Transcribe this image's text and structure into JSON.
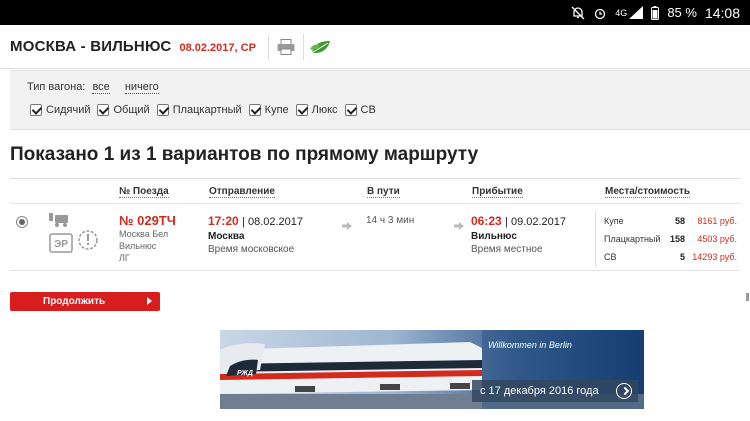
{
  "status_bar": {
    "battery_level": "85 %",
    "network": "4G",
    "time": "14:08"
  },
  "header": {
    "route": "МОСКВА - ВИЛЬНЮС",
    "date": "08.02.2017, СР",
    "print_icon": "printer-icon",
    "eco_icon": "leaf-icon"
  },
  "filter": {
    "type_label": "Тип вагона:",
    "link_all": "все",
    "link_none": "ничего",
    "options": [
      {
        "label": "Сидячий",
        "checked": true
      },
      {
        "label": "Общий",
        "checked": true
      },
      {
        "label": "Плацкартный",
        "checked": true
      },
      {
        "label": "Купе",
        "checked": true
      },
      {
        "label": "Люкс",
        "checked": true
      },
      {
        "label": "СВ",
        "checked": true
      }
    ]
  },
  "results": {
    "title": "Показано 1 из 1 вариантов по прямому маршруту"
  },
  "table": {
    "columns": {
      "train": "№ Поезда",
      "departure": "Отправление",
      "travel": "В пути",
      "arrival": "Прибытие",
      "seats": "Места/стоимость"
    },
    "row": {
      "train_number": "№ 029ТЧ",
      "train_route": [
        "Москва Бел",
        "Вильнюс",
        "ЛГ"
      ],
      "er_badge": "ЭР",
      "departure_time": "17:20",
      "departure_date": "| 08.02.2017",
      "departure_city": "Москва",
      "departure_tz": "Время московское",
      "duration": "14 ч 3 мин",
      "arrival_time": "06:23",
      "arrival_date": "| 09.02.2017",
      "arrival_city": "Вильнюс",
      "arrival_tz": "Время местное",
      "seats": [
        {
          "type": "Купе",
          "count": "58",
          "price": "8161 руб."
        },
        {
          "type": "Плацкартный",
          "count": "158",
          "price": "4503 руб."
        },
        {
          "type": "СВ",
          "count": "5",
          "price": "14293 руб."
        }
      ]
    }
  },
  "continue_button": "Продолжить",
  "banner": {
    "caption": "Willkommen in Berlin",
    "date_text": "с 17 декабря 2016 года"
  },
  "colors": {
    "accent_red": "#d42a1e",
    "button_red": "#d71d1d"
  }
}
